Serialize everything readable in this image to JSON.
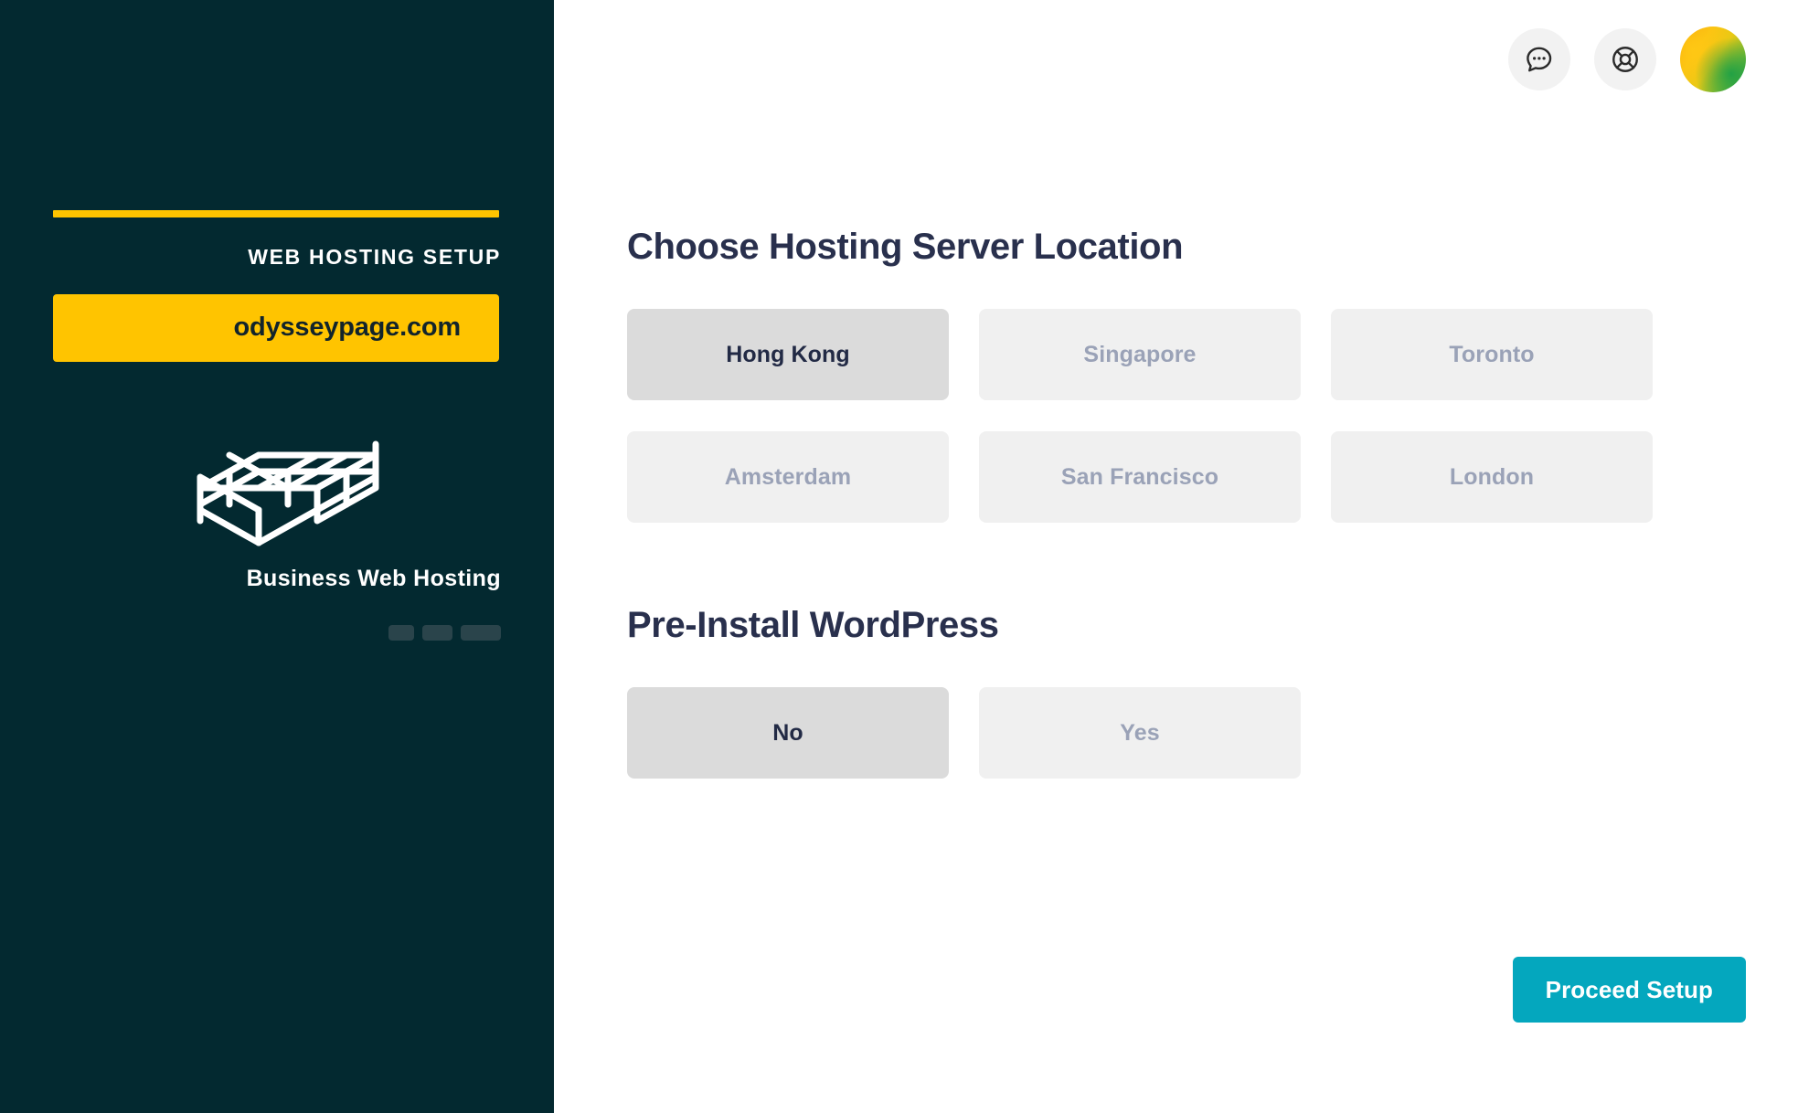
{
  "sidebar": {
    "eyebrow": "WEB HOSTING SETUP",
    "domain": "odysseypage.com",
    "plan_name": "Business Web Hosting",
    "illustration_icon": "isometric-server-blocks-icon",
    "accent_color": "#FFC400",
    "background_color": "#032930",
    "progress": {
      "segments": [
        "step-1",
        "step-2",
        "step-3-active"
      ],
      "active_index": 2
    }
  },
  "topbar": {
    "chat_icon": "chat-bubble-icon",
    "support_icon": "lifebuoy-icon",
    "avatar_icon": "user-avatar"
  },
  "main": {
    "sections": [
      {
        "title": "Choose Hosting Server Location",
        "selected": "Hong Kong",
        "options": [
          {
            "label": "Hong Kong",
            "selected": true
          },
          {
            "label": "Singapore",
            "selected": false
          },
          {
            "label": "Toronto",
            "selected": false
          },
          {
            "label": "Amsterdam",
            "selected": false
          },
          {
            "label": "San Francisco",
            "selected": false
          },
          {
            "label": "London",
            "selected": false
          }
        ]
      },
      {
        "title": "Pre-Install WordPress",
        "selected": "No",
        "options": [
          {
            "label": "No",
            "selected": true
          },
          {
            "label": "Yes",
            "selected": false
          }
        ]
      }
    ],
    "primary_action": "Proceed Setup",
    "accent_color": "#04A7BE",
    "selected_option_bg": "#DBDBDB",
    "option_bg": "#F0F0F0"
  }
}
